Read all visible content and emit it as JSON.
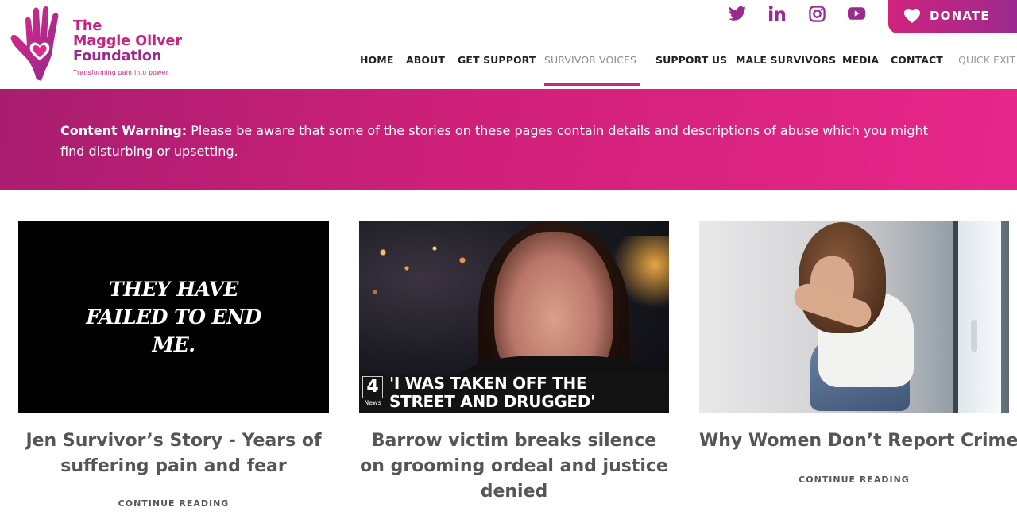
{
  "brand": {
    "name_line1": "The",
    "name_line2": "Maggie Oliver",
    "name_line3": "Foundation",
    "tagline": "Transforming pain into power"
  },
  "social": {
    "items": [
      "twitter-icon",
      "linkedin-icon",
      "instagram-icon",
      "youtube-icon"
    ],
    "color": "#9b2a8e"
  },
  "donate": {
    "label": "DONATE"
  },
  "nav": {
    "items": [
      {
        "label": "HOME"
      },
      {
        "label": "ABOUT"
      },
      {
        "label": "GET SUPPORT"
      },
      {
        "label": "SURVIVOR VOICES",
        "active": true
      },
      {
        "label": "SUPPORT US"
      },
      {
        "label": "MALE SURVIVORS"
      },
      {
        "label": "MEDIA"
      },
      {
        "label": "CONTACT"
      },
      {
        "label": "QUICK EXIT"
      }
    ]
  },
  "banner": {
    "label": "Content Warning:",
    "text": " Please be aware that some of the stories on these pages contain details and descriptions of abuse which you might find disturbing or upsetting."
  },
  "cards": [
    {
      "image_text": "THEY HAVE FAILED TO END ME.",
      "title": "Jen Survivor’s Story - Years of suffering pain and fear",
      "link": "CONTINUE READING"
    },
    {
      "image_caption": "'I WAS TAKEN OFF THE STREET AND DRUGGED'",
      "image_logo_mark": "4",
      "image_logo_text": "News",
      "title": "Barrow victim breaks silence on grooming ordeal and justice denied",
      "link": "CONTINUE READING"
    },
    {
      "title": "Why Women Don’t Report Crimes",
      "link": "CONTINUE READING"
    }
  ],
  "colors": {
    "brand_pink": "#c8217f",
    "brand_purple": "#9b2a8e",
    "banner_start": "#a81d6f",
    "banner_end": "#e72689"
  }
}
